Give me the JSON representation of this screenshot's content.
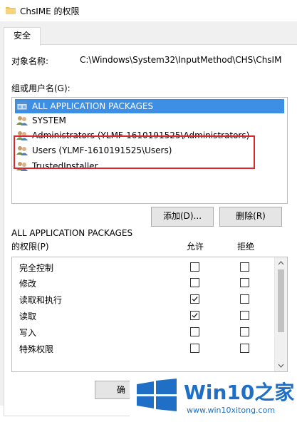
{
  "window": {
    "title": "ChsIME 的权限"
  },
  "tabs": [
    {
      "label": "安全"
    }
  ],
  "object": {
    "label": "对象名称:",
    "value": "C:\\Windows\\System32\\InputMethod\\CHS\\ChsIM"
  },
  "groups": {
    "label": "组或用户名(G):",
    "items": [
      {
        "label": "ALL APPLICATION PACKAGES",
        "selected": true
      },
      {
        "label": "SYSTEM"
      },
      {
        "label": "Administrators (YLMF-1610191525\\Administrators)"
      },
      {
        "label": "Users (YLMF-1610191525\\Users)"
      },
      {
        "label": "TrustedInstaller"
      }
    ]
  },
  "buttons": {
    "add": "添加(D)...",
    "remove": "删除(R)",
    "ok": "确"
  },
  "permissions": {
    "for_label": "ALL APPLICATION PACKAGES",
    "p_label": "的权限(P)",
    "allow_header": "允许",
    "deny_header": "拒绝",
    "rows": [
      {
        "name": "完全控制",
        "allow": false,
        "deny": false
      },
      {
        "name": "修改",
        "allow": false,
        "deny": false
      },
      {
        "name": "读取和执行",
        "allow": true,
        "deny": false
      },
      {
        "name": "读取",
        "allow": true,
        "deny": false
      },
      {
        "name": "写入",
        "allow": false,
        "deny": false
      },
      {
        "name": "特殊权限",
        "allow": false,
        "deny": false
      }
    ]
  },
  "watermark": {
    "brand_main": "Win10",
    "brand_suffix": "之家",
    "url": "www.win10xitong.com"
  },
  "colors": {
    "selection": "#3d8ee5",
    "highlight_border": "#d9292e",
    "brand": "#1e6fc5"
  }
}
